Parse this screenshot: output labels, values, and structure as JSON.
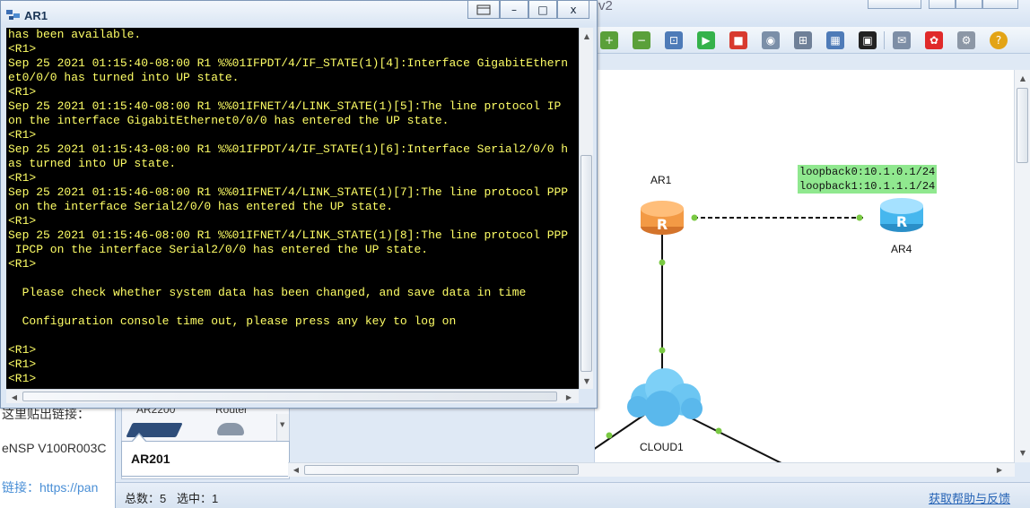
{
  "background_page": {
    "line1": "这里贴出链接：",
    "line2": "eNSP V100R003C",
    "line3": "链接：https://pan"
  },
  "ensp": {
    "title_partial": "v2",
    "toolbar_icons": [
      "zoom-in-icon",
      "zoom-out-icon",
      "fit-icon",
      "start-icon",
      "stop-icon",
      "capture-icon",
      "topology-icon",
      "grid-icon",
      "terminal-icon",
      "chat-icon",
      "huawei-logo-icon",
      "settings-icon",
      "help-icon"
    ],
    "device_panel": {
      "top_labels": [
        "AR2200",
        "Router"
      ],
      "selected_model": "AR201"
    },
    "status": {
      "total": "总数：5",
      "selected": "选中：1",
      "help_link": "获取帮助与反馈"
    },
    "topology": {
      "nodes": [
        {
          "name": "AR1",
          "type": "router",
          "color": "#f39a45"
        },
        {
          "name": "AR4",
          "type": "router",
          "color": "#46b7ee"
        },
        {
          "name": "CLOUD1",
          "type": "cloud",
          "color": "#5ab8ec"
        }
      ],
      "note_line1": "loopback0:10.1.0.1/24",
      "note_line2": "loopback1:10.1.1.1/24",
      "note_color": "#90e88f",
      "link_dot_color": "#7ac943"
    }
  },
  "console": {
    "title": "AR1",
    "buttons": {
      "minimize": "–",
      "maximize": "□",
      "close": "x"
    },
    "text_color": "#ffff66",
    "lines": [
      "has been available.",
      "<R1>",
      "Sep 25 2021 01:15:40-08:00 R1 %%01IFPDT/4/IF_STATE(1)[4]:Interface GigabitEthern",
      "et0/0/0 has turned into UP state.",
      "<R1>",
      "Sep 25 2021 01:15:40-08:00 R1 %%01IFNET/4/LINK_STATE(1)[5]:The line protocol IP",
      "on the interface GigabitEthernet0/0/0 has entered the UP state.",
      "<R1>",
      "Sep 25 2021 01:15:43-08:00 R1 %%01IFPDT/4/IF_STATE(1)[6]:Interface Serial2/0/0 h",
      "as turned into UP state.",
      "<R1>",
      "Sep 25 2021 01:15:46-08:00 R1 %%01IFNET/4/LINK_STATE(1)[7]:The line protocol PPP",
      " on the interface Serial2/0/0 has entered the UP state.",
      "<R1>",
      "Sep 25 2021 01:15:46-08:00 R1 %%01IFNET/4/LINK_STATE(1)[8]:The line protocol PPP",
      " IPCP on the interface Serial2/0/0 has entered the UP state.",
      "<R1>",
      "",
      "  Please check whether system data has been changed, and save data in time",
      "",
      "  Configuration console time out, please press any key to log on",
      "",
      "<R1>",
      "<R1>",
      "<R1>"
    ]
  }
}
